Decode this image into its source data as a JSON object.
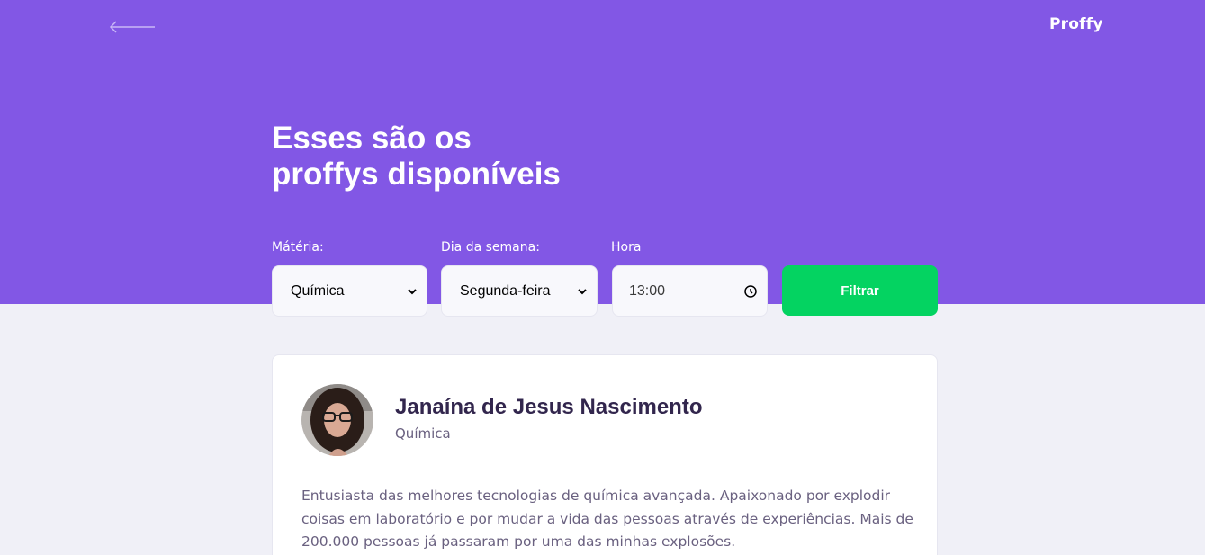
{
  "header": {
    "logo": "Proffy",
    "back_label": "back",
    "title_line1": "Esses são os",
    "title_line2": "proffys disponíveis"
  },
  "filters": {
    "subject_label": "Mátéria:",
    "subject_value": "Química",
    "weekday_label": "Dia da semana:",
    "weekday_value": "Segunda-feira",
    "time_label": "Hora",
    "time_value": "13:00",
    "filter_button": "Filtrar"
  },
  "teacher": {
    "name": "Janaína de Jesus Nascimento",
    "subject": "Química",
    "bio": "Entusiasta das melhores tecnologias de química avançada. Apaixonado por explodir coisas em laboratório e por mudar a vida das pessoas através de experiências. Mais de 200.000 pessoas já passaram por uma das minhas explosões."
  },
  "colors": {
    "primary": "#8257e5",
    "background": "#f0f0f7",
    "filter_button": "#04d361",
    "title_text": "#32264d",
    "body_text": "#6a6180"
  },
  "icons": {
    "back": "arrow-left-icon",
    "chevron": "chevron-down-icon",
    "clock": "clock-icon"
  }
}
